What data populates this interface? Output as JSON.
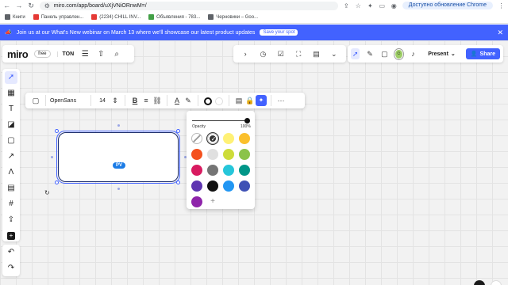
{
  "browser": {
    "url": "miro.com/app/board/uXjVNiORnwM=/",
    "update_button": "Доступно обновление Chrome",
    "bookmarks": [
      {
        "label": "Книги",
        "color": "#5f6368"
      },
      {
        "label": "Панель управлен...",
        "color": "#e53935"
      },
      {
        "label": "(2234) CHILL INV...",
        "color": "#e53935"
      },
      {
        "label": "Объявления - 783...",
        "color": "#43a047"
      },
      {
        "label": "Черновики – Goo...",
        "color": "#5f6368"
      }
    ]
  },
  "banner": {
    "text": "Join us at our What's New webinar on March 13 where we'll showcase our latest product updates",
    "button": "Save your spot",
    "emoji": "📣"
  },
  "board": {
    "logo": "miro",
    "plan": "free",
    "name": "TON"
  },
  "collab": {
    "present": "Present",
    "share": "Share"
  },
  "format_bar": {
    "font": "OpenSans",
    "size": "14"
  },
  "shape": {
    "cursor_label": "PV"
  },
  "palette": {
    "opacity_label": "Opacity",
    "opacity_value": "100%",
    "opacity_fraction": 1.0,
    "swatches": [
      [
        "none",
        "#ffffff",
        "#fff176",
        "#fbc02d"
      ],
      [
        "#f4511e",
        "#e0e0e0",
        "#cddc39",
        "#8bc34a"
      ],
      [
        "#d81b60",
        "#757575",
        "#26c6da",
        "#009688"
      ],
      [
        "#5e35b1",
        "#111111",
        "#2196f3",
        "#3f51b5"
      ],
      [
        "#8e24aa"
      ]
    ],
    "selected": "#ffffff"
  },
  "colors": {
    "accent": "#4262ff",
    "shape_border": "#1a2b6b",
    "cursor_tag": "#1c7ce6"
  }
}
